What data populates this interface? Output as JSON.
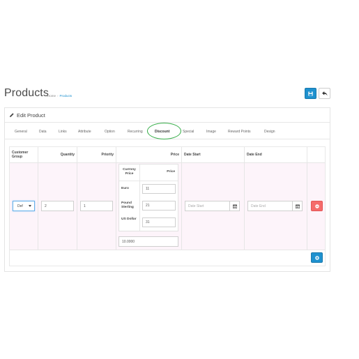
{
  "header": {
    "title": "Products",
    "breadcrumb": [
      "Home",
      "Products"
    ]
  },
  "panel": {
    "title": "Edit Product"
  },
  "tabs": [
    "General",
    "Data",
    "Links",
    "Attribute",
    "Option",
    "Recurring",
    "Discount",
    "Special",
    "Image",
    "Reward Points",
    "Design"
  ],
  "active_tab": "Discount",
  "table": {
    "headers": [
      "Customer Group",
      "Quantity",
      "Priority",
      "Price",
      "Date Start",
      "Date End"
    ],
    "row": {
      "customer_group": "Def",
      "quantity": "2",
      "priority": "1",
      "price": "10.0000",
      "date_start_placeholder": "Date Start",
      "date_end_placeholder": "Date End"
    },
    "price_table": {
      "headers": [
        "Currnny Price",
        "Price"
      ],
      "rows": [
        {
          "currency": "Euro",
          "price": "11"
        },
        {
          "currency": "Pound Sterling",
          "price": "21"
        },
        {
          "currency": "US Dollar",
          "price": "31"
        }
      ]
    }
  },
  "colors": {
    "primary": "#1e91cf",
    "danger": "#f56b6b",
    "highlight": "#3aaf4c"
  }
}
